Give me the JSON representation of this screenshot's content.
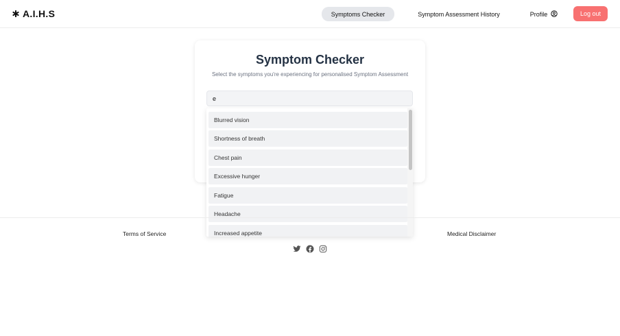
{
  "header": {
    "brand": "A.I.H.S",
    "nav": {
      "symptoms_checker": "Symptoms Checker",
      "history": "Symptom Assessment History",
      "profile": "Profile",
      "logout": "Log out"
    }
  },
  "card": {
    "title": "Symptom Checker",
    "subtitle": "Select the symptoms you're experiencing for personalised Symptom Assessment",
    "search_value": "e"
  },
  "dropdown": {
    "options": [
      "Blurred vision",
      "Shortness of breath",
      "Chest pain",
      "Excessive hunger",
      "Fatigue",
      "Headache",
      "Increased appetite"
    ]
  },
  "footer": {
    "terms": "Terms of Service",
    "disclaimer": "Medical Disclaimer"
  },
  "colors": {
    "accent": "#f87171",
    "active_nav": "#e5e7eb",
    "title": "#243244"
  },
  "icons": [
    "asterisk-icon",
    "user-circle-icon",
    "twitter-icon",
    "facebook-icon",
    "instagram-icon"
  ]
}
